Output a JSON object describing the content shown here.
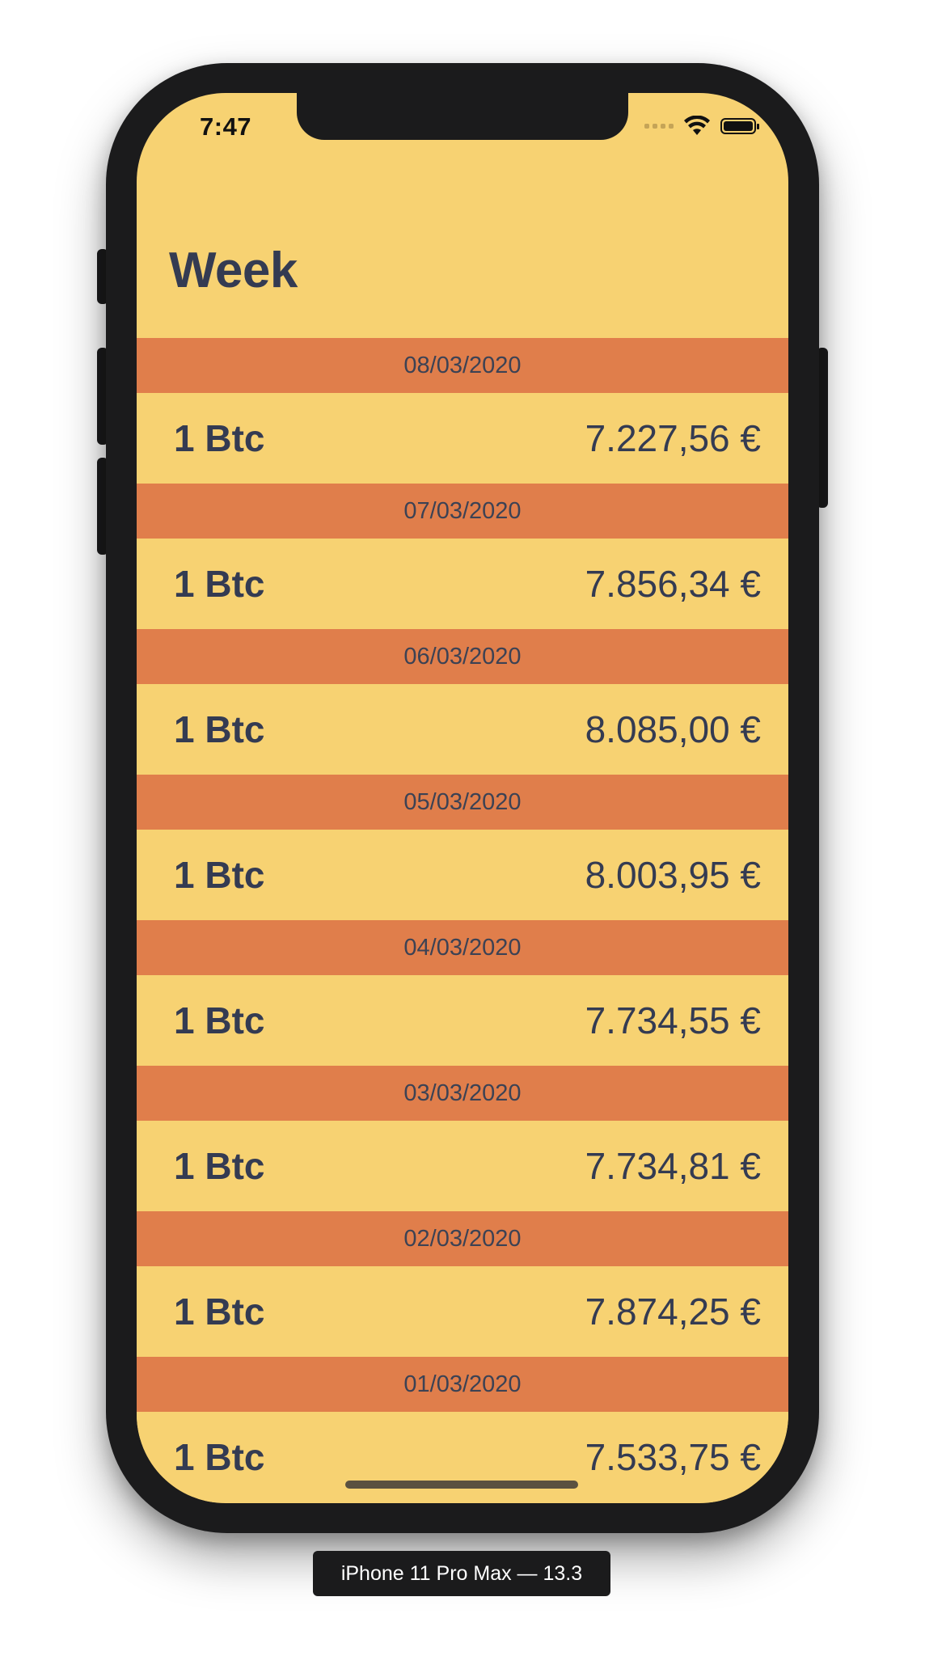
{
  "status_bar": {
    "time": "7:47",
    "icons": [
      "signal-icon",
      "wifi-icon",
      "battery-icon"
    ]
  },
  "nav": {
    "title": "Week"
  },
  "entries": [
    {
      "date": "08/03/2020",
      "unit": "1 Btc",
      "price": "7.227,56 €"
    },
    {
      "date": "07/03/2020",
      "unit": "1 Btc",
      "price": "7.856,34 €"
    },
    {
      "date": "06/03/2020",
      "unit": "1 Btc",
      "price": "8.085,00 €"
    },
    {
      "date": "05/03/2020",
      "unit": "1 Btc",
      "price": "8.003,95 €"
    },
    {
      "date": "04/03/2020",
      "unit": "1 Btc",
      "price": "7.734,55 €"
    },
    {
      "date": "03/03/2020",
      "unit": "1 Btc",
      "price": "7.734,81 €"
    },
    {
      "date": "02/03/2020",
      "unit": "1 Btc",
      "price": "7.874,25 €"
    },
    {
      "date": "01/03/2020",
      "unit": "1 Btc",
      "price": "7.533,75 €"
    }
  ],
  "device_label": "iPhone 11 Pro Max — 13.3",
  "colors": {
    "background": "#f7d272",
    "section_header": "#e07e4b",
    "text": "#343b52",
    "device_frame": "#1b1b1c"
  }
}
